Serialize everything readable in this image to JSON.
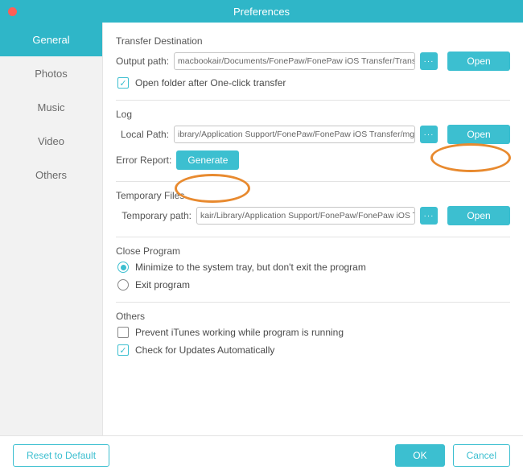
{
  "window": {
    "title": "Preferences"
  },
  "sidebar": {
    "items": [
      {
        "label": "General",
        "active": true
      },
      {
        "label": "Photos",
        "active": false
      },
      {
        "label": "Music",
        "active": false
      },
      {
        "label": "Video",
        "active": false
      },
      {
        "label": "Others",
        "active": false
      }
    ]
  },
  "sections": {
    "transfer": {
      "title": "Transfer Destination",
      "output_label": "Output path:",
      "output_value": "macbookair/Documents/FonePaw/FonePaw iOS Transfer/TransferDir",
      "browse_label": "···",
      "open_label": "Open",
      "open_folder_checkbox_label": "Open folder after One-click transfer",
      "open_folder_checked": true
    },
    "log": {
      "title": "Log",
      "local_path_label": "Local Path:",
      "local_path_value": "ibrary/Application Support/FonePaw/FonePaw iOS Transfer/mg_log.log",
      "browse_label": "···",
      "open_label": "Open",
      "error_report_label": "Error Report:",
      "generate_label": "Generate"
    },
    "temp": {
      "title": "Temporary Files",
      "temp_path_label": "Temporary path:",
      "temp_path_value": "kair/Library/Application Support/FonePaw/FonePaw iOS Transfer",
      "browse_label": "···",
      "open_label": "Open"
    },
    "close_program": {
      "title": "Close Program",
      "minimize_label": "Minimize to the system tray, but don't exit the program",
      "exit_label": "Exit program",
      "selected": "minimize"
    },
    "others": {
      "title": "Others",
      "prevent_itunes_label": "Prevent iTunes working while program is running",
      "prevent_itunes_checked": false,
      "check_updates_label": "Check for Updates Automatically",
      "check_updates_checked": true
    }
  },
  "footer": {
    "reset_label": "Reset to Default",
    "ok_label": "OK",
    "cancel_label": "Cancel"
  },
  "colors": {
    "accent": "#3cbfd0",
    "highlight": "#e88a2f"
  }
}
